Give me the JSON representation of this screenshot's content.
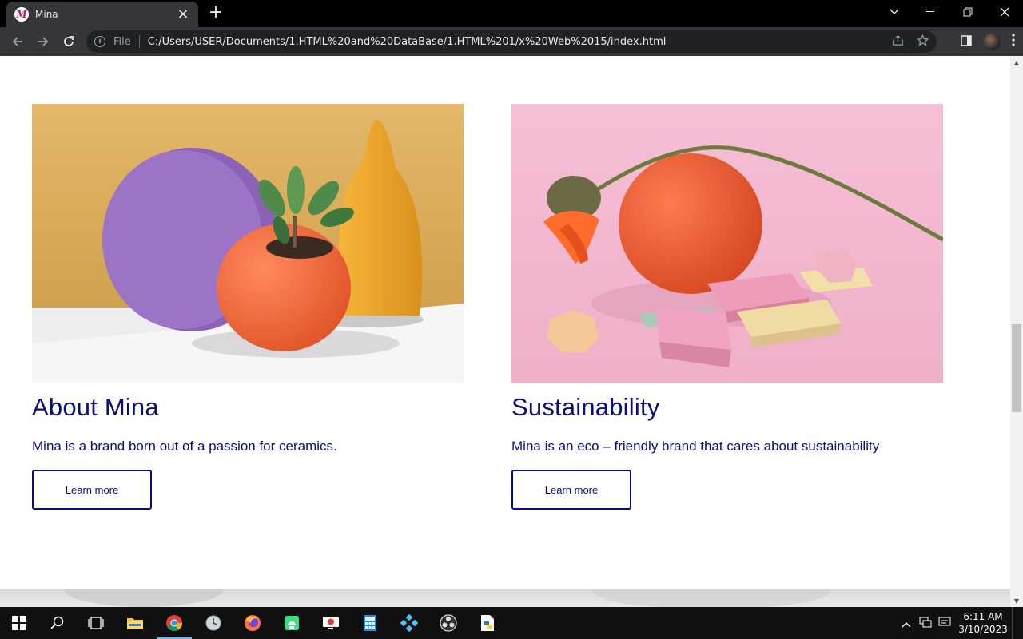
{
  "browser": {
    "tab_title": "Mina",
    "tab_favicon": "M",
    "file_label": "File",
    "url": "C:/Users/USER/Documents/1.HTML%20and%20DataBase/1.HTML%201/x%20Web%2015/index.html"
  },
  "cards": [
    {
      "title": "About Mina",
      "text": "Mina is a brand born out of a passion for ceramics.",
      "button": "Learn more"
    },
    {
      "title": "Sustainability",
      "text": "Mina is an eco – friendly brand that cares about sustainability",
      "button": "Learn more"
    }
  ],
  "taskbar": {
    "time": "6:11 AM",
    "date": "3/10/2023"
  },
  "colors": {
    "brand_navy": "#0b0d7c",
    "browser_dark": "#35363a"
  }
}
